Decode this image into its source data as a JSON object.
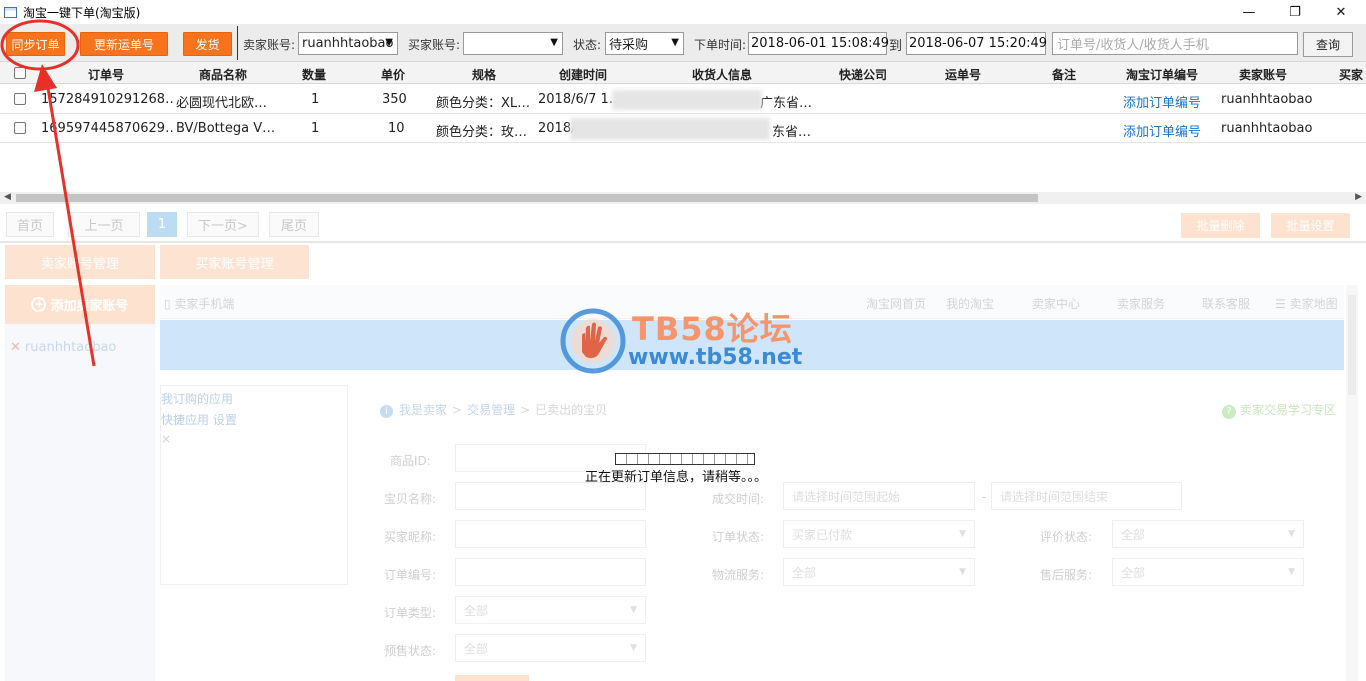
{
  "window": {
    "title": "淘宝一键下单(淘宝版)",
    "controls": {
      "minimize": "—",
      "maximize": "❐",
      "close": "✕"
    }
  },
  "toolbar": {
    "sync_label": "同步订单",
    "update_label": "更新运单号",
    "ship_label": "发货",
    "seller_label": "卖家账号:",
    "seller_value": "ruanhhtaobao",
    "buyer_label": "买家账号:",
    "buyer_value": "",
    "status_label": "状态:",
    "status_value": "待采购",
    "time_label": "下单时间:",
    "time_from": "2018-06-01 15:08:49",
    "time_to_label": "到",
    "time_to": "2018-06-07 15:20:49",
    "search_placeholder": "订单号/收货人/收货人手机",
    "query_label": "查询"
  },
  "grid": {
    "columns": [
      "订单号",
      "商品名称",
      "数量",
      "单价",
      "规格",
      "创建时间",
      "收货人信息",
      "快递公司",
      "运单号",
      "备注",
      "淘宝订单编号",
      "卖家账号",
      "买家"
    ],
    "rows": [
      {
        "order_no": "157284910291268…",
        "product": "必圆现代北欧…",
        "qty": "1",
        "price": "350",
        "spec": "颜色分类：XL…",
        "created": "2018/6/7 1…",
        "receiver": "广东省…",
        "tb_order_link": "添加订单编号",
        "seller": "ruanhhtaobao"
      },
      {
        "order_no": "169597445870629…",
        "product": "BV/Bottega V…",
        "qty": "1",
        "price": "10",
        "spec": "颜色分类：玫…",
        "created": "2018/…",
        "receiver": "东省…",
        "tb_order_link": "添加订单编号",
        "seller": "ruanhhtaobao"
      }
    ]
  },
  "pager": {
    "first": "首页",
    "prev": "上一页",
    "current": "1",
    "next": "下一页>",
    "last": "尾页",
    "batch_delete": "批量删除",
    "batch_settings": "批量设置"
  },
  "lower": {
    "tab_seller": "卖家账号管理",
    "tab_buyer": "买家账号管理",
    "add_seller": "添加卖家账号",
    "account": "ruanhhtaobao",
    "topnav": [
      "卖家手机端",
      "淘宝网首页",
      "我的淘宝",
      "卖家中心",
      "卖家服务",
      "联系客服",
      "卖家地图"
    ],
    "apps": [
      "我订购的应用",
      "快捷应用 设置"
    ],
    "app_close": "×",
    "crumb": [
      "我是卖家",
      "交易管理",
      "已卖出的宝贝"
    ],
    "learn": "卖家交易学习专区",
    "form": {
      "item_id": "商品ID:",
      "item_name": "宝贝名称:",
      "buyer_nick": "买家昵称:",
      "order_no": "订单编号:",
      "order_type": "订单类型:",
      "presale": "预售状态:",
      "deal_time": "成交时间:",
      "time_start_ph": "请选择时间范围起始",
      "time_end_ph": "请选择时间范围结束",
      "order_status": "订单状态:",
      "order_status_val": "买家已付款",
      "logistics": "物流服务:",
      "rating": "评价状态:",
      "aftersale": "售后服务:",
      "all": "全部"
    }
  },
  "loading": {
    "text": "正在更新订单信息，请稍等。。。"
  },
  "watermark": {
    "title": "TB58论坛",
    "url": "www.tb58.net"
  },
  "colors": {
    "accent": "#f7731c",
    "link": "#1a73c8",
    "annotation": "#e8302a"
  }
}
